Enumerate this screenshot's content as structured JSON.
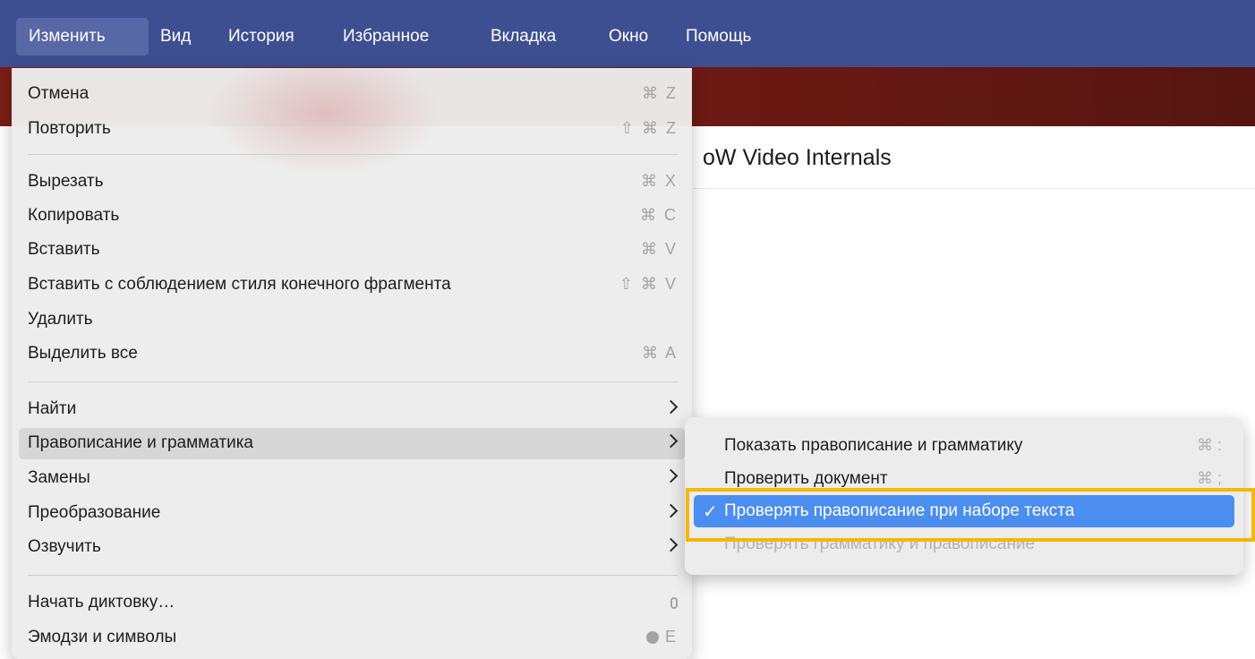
{
  "menubar": {
    "items": [
      "Изменить",
      "Вид",
      "История",
      "Избранное",
      "Вкладка",
      "Окно",
      "Помощь"
    ]
  },
  "page": {
    "title": "oW Video Internals"
  },
  "edit_menu": {
    "items": [
      {
        "label": "Отмена",
        "shortcut": "⌘ Z"
      },
      {
        "label": "Повторить",
        "shortcut": "⇧ ⌘ Z"
      },
      {
        "label": "Вырезать",
        "shortcut": "⌘ X"
      },
      {
        "label": "Копировать",
        "shortcut": "⌘ C"
      },
      {
        "label": "Вставить",
        "shortcut": "⌘ V"
      },
      {
        "label": "Вставить с соблюдением стиля конечного фрагмента",
        "shortcut": "⇧ ⌘ V"
      },
      {
        "label": "Удалить",
        "shortcut": ""
      },
      {
        "label": "Выделить все",
        "shortcut": "⌘ A"
      },
      {
        "label": "Найти"
      },
      {
        "label": "Правописание и грамматика"
      },
      {
        "label": "Замены"
      },
      {
        "label": "Преобразование"
      },
      {
        "label": "Озвучить"
      },
      {
        "label": "Начать диктовку…",
        "icon": "microphone-icon"
      },
      {
        "label": "Эмодзи и символы",
        "icon": "globe-icon",
        "shortcut": "E"
      }
    ]
  },
  "spelling_submenu": {
    "items": [
      {
        "label": "Показать правописание и грамматику",
        "shortcut": "⌘ :"
      },
      {
        "label": "Проверить документ",
        "shortcut": "⌘ ;"
      },
      {
        "label": "Проверять правописание при наборе текста",
        "checked": true
      },
      {
        "label": "Проверять грамматику и правописание",
        "disabled": true
      }
    ]
  },
  "colors": {
    "menubar": "#3d4f91",
    "selection": "#4b8ef0",
    "focus_outline": "#f5b700"
  }
}
